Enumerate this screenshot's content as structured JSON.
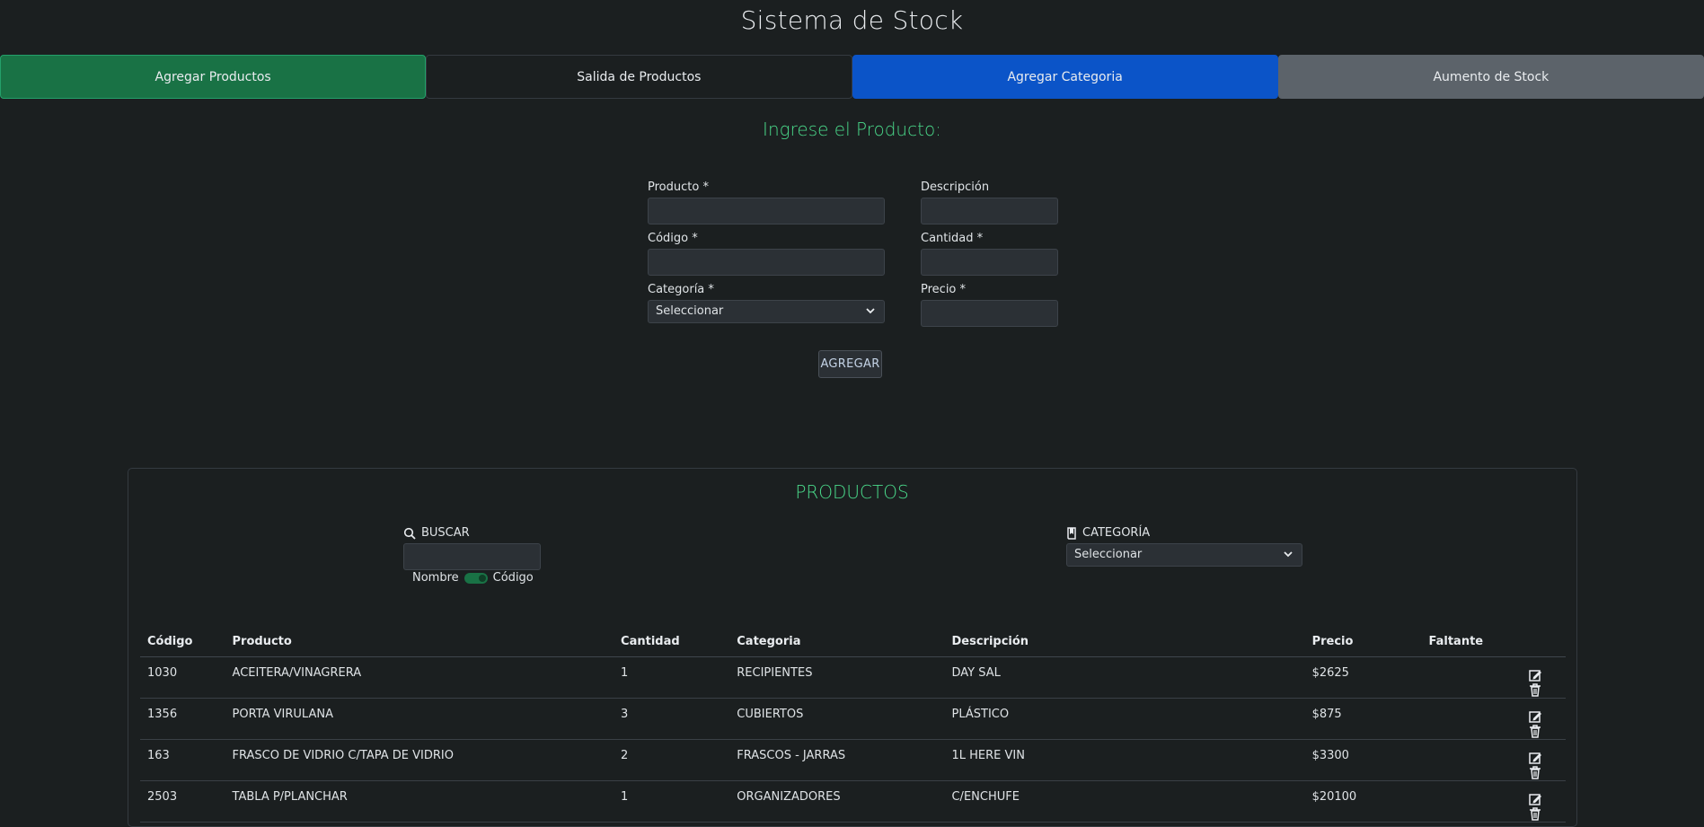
{
  "app": {
    "title": "Sistema de Stock"
  },
  "tabs": [
    {
      "label": "Agregar Productos",
      "color": "#197245"
    },
    {
      "label": "Salida de Productos",
      "color": "#1b1f20"
    },
    {
      "label": "Agregar Categoria",
      "color": "#0b54c8"
    },
    {
      "label": "Aumento de Stock",
      "color": "#5c636a"
    }
  ],
  "form": {
    "title": "Ingrese el Producto:",
    "fields": {
      "producto": {
        "label": "Producto *",
        "value": ""
      },
      "descripcion": {
        "label": "Descripción",
        "value": ""
      },
      "codigo": {
        "label": "Código *",
        "value": ""
      },
      "cantidad": {
        "label": "Cantidad *",
        "value": ""
      },
      "categoria": {
        "label": "Categoría *",
        "selected": "Seleccionar"
      },
      "precio": {
        "label": "Precio *",
        "value": ""
      }
    },
    "submit_label": "AGREGAR"
  },
  "products": {
    "title": "PRODUCTOS",
    "search": {
      "label": "BUSCAR",
      "icon": "search-icon",
      "value": "",
      "toggle_left": "Nombre",
      "toggle_right": "Código"
    },
    "category_filter": {
      "label": "CATEGORÍA",
      "icon": "book-icon",
      "selected": "Seleccionar"
    },
    "table": {
      "headers": [
        "Código",
        "Producto",
        "Cantidad",
        "Categoria",
        "Descripción",
        "Precio",
        "Faltante"
      ],
      "rows": [
        {
          "codigo": "1030",
          "producto": "ACEITERA/VINAGRERA",
          "cantidad": "1",
          "categoria": "RECIPIENTES",
          "descripcion": "DAY SAL",
          "precio": "$2625",
          "faltante": ""
        },
        {
          "codigo": "1356",
          "producto": "PORTA VIRULANA",
          "cantidad": "3",
          "categoria": "CUBIERTOS",
          "descripcion": "PLÁSTICO",
          "precio": "$875",
          "faltante": ""
        },
        {
          "codigo": "163",
          "producto": "FRASCO DE VIDRIO C/TAPA DE VIDRIO",
          "cantidad": "2",
          "categoria": "FRASCOS - JARRAS",
          "descripcion": "1L HERE VIN",
          "precio": "$3300",
          "faltante": ""
        },
        {
          "codigo": "2503",
          "producto": "TABLA P/PLANCHAR",
          "cantidad": "1",
          "categoria": "ORGANIZADORES",
          "descripcion": "C/ENCHUFE",
          "precio": "$20100",
          "faltante": ""
        }
      ]
    }
  },
  "colors": {
    "accent_green": "#4ad98a",
    "background": "#1b1f20"
  }
}
